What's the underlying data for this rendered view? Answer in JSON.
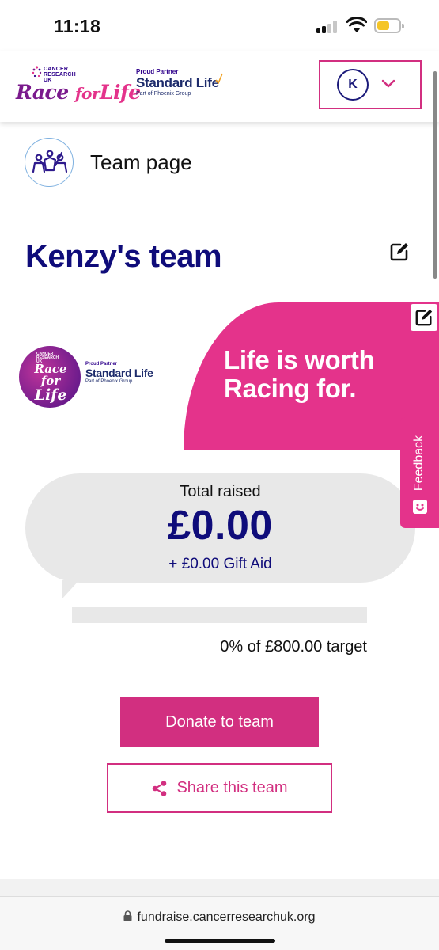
{
  "status_bar": {
    "time": "11:18"
  },
  "header": {
    "logo_org_lines": [
      "CANCER",
      "RESEARCH",
      "UK"
    ],
    "logo_race": "Race",
    "logo_for": "for",
    "logo_life": "Life",
    "partner_caption": "Proud Partner",
    "partner_name": "Standard Life",
    "partner_group": "Part of Phoenix Group",
    "avatar_initial": "K"
  },
  "team_nav": {
    "label": "Team page"
  },
  "team": {
    "title": "Kenzy's team"
  },
  "banner": {
    "tagline_line1": "Life is worth",
    "tagline_line2": "Racing for.",
    "logo_race": "Race for",
    "logo_life": "Life",
    "partner_caption": "Proud Partner",
    "partner_name": "Standard Life",
    "partner_group": "Part of Phoenix Group"
  },
  "feedback": {
    "label": "Feedback"
  },
  "fundraising": {
    "total_label": "Total raised",
    "total_amount": "£0.00",
    "gift_aid": "+ £0.00 Gift Aid",
    "progress_percent": 0,
    "progress_text": "0% of £800.00 target"
  },
  "actions": {
    "donate_label": "Donate to team",
    "share_label": "Share this team"
  },
  "browser": {
    "url": "fundraise.cancerresearchuk.org"
  },
  "colors": {
    "brand_pink": "#e4338b",
    "button_pink": "#d22f80",
    "navy": "#0f0c7a"
  }
}
